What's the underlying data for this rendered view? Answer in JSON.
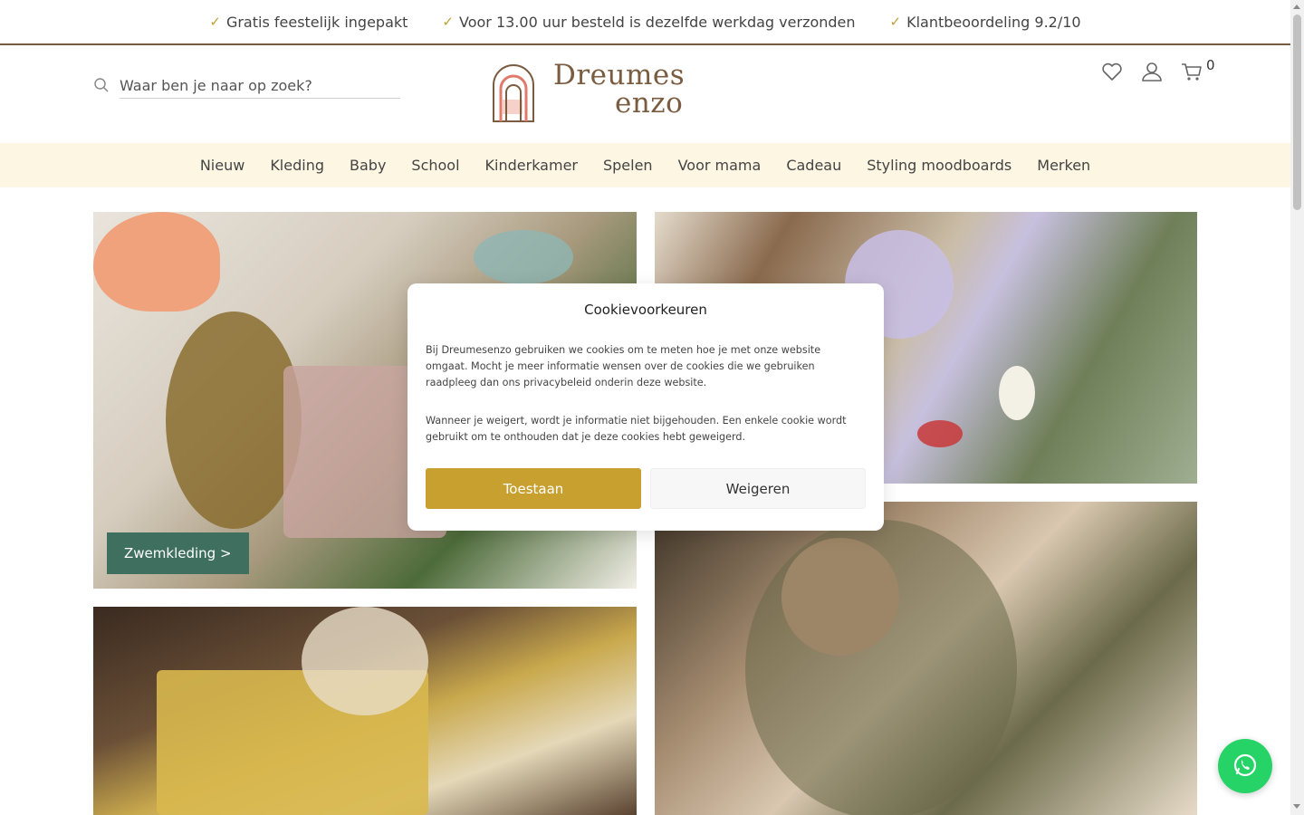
{
  "usp": [
    {
      "label": "Gratis feestelijk ingepakt",
      "icon": "check-icon"
    },
    {
      "label": "Voor 13.00 uur besteld is dezelfde werkdag verzonden",
      "icon": "check-icon"
    },
    {
      "label": "Klantbeoordeling 9.2/10",
      "icon": "check-icon"
    }
  ],
  "search": {
    "placeholder": "Waar ben je naar op zoek?",
    "icon": "search-icon"
  },
  "logo": {
    "line1": "Dreumes",
    "line2": "enzo"
  },
  "header_icons": {
    "wishlist": "heart-icon",
    "account": "user-icon",
    "cart": "cart-icon",
    "cart_count": "0"
  },
  "nav": [
    "Nieuw",
    "Kleding",
    "Baby",
    "School",
    "Kinderkamer",
    "Spelen",
    "Voor mama",
    "Cadeau",
    "Styling moodboards",
    "Merken"
  ],
  "tiles": {
    "swim_button": "Zwemkleding >"
  },
  "cookie_modal": {
    "title": "Cookievoorkeuren",
    "text1": "Bij Dreumesenzo gebruiken we cookies om te meten hoe je met onze website omgaat. Mocht je meer informatie wensen over de cookies die we gebruiken raadpleeg dan ons privacybeleid onderin deze website.",
    "text2": "Wanneer je weigert, wordt je informatie niet bijgehouden. Een enkele cookie wordt gebruikt om te onthouden dat je deze cookies hebt geweigerd.",
    "accept": "Toestaan",
    "deny": "Weigeren"
  },
  "colors": {
    "accent": "#c8a030",
    "brand": "#7a5c40",
    "nav_bg": "#fdf6e3",
    "whatsapp": "#25d366"
  }
}
